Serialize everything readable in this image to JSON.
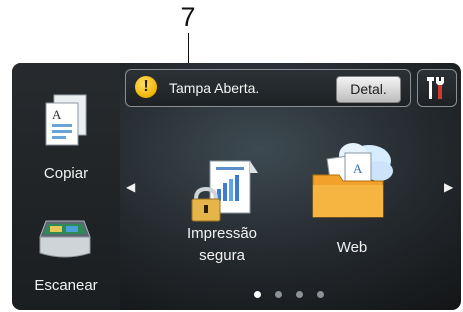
{
  "callout": {
    "number": "7"
  },
  "sidebar": {
    "items": [
      {
        "label": "Copiar"
      },
      {
        "label": "Escanear"
      }
    ]
  },
  "status": {
    "message": "Tampa Aberta.",
    "warning_glyph": "!",
    "detail_button": "Detal."
  },
  "apps": [
    {
      "label_line1": "Impressão",
      "label_line2": "segura"
    },
    {
      "label_line1": "Web"
    }
  ],
  "pager": {
    "pages": 4,
    "current": 1
  },
  "icons": {
    "left_arrow": "◀",
    "right_arrow": "▶",
    "settings": "tools-icon",
    "warning": "warning-icon"
  },
  "colors": {
    "warning": "#f1b400",
    "screen_bg": "#24292d"
  }
}
